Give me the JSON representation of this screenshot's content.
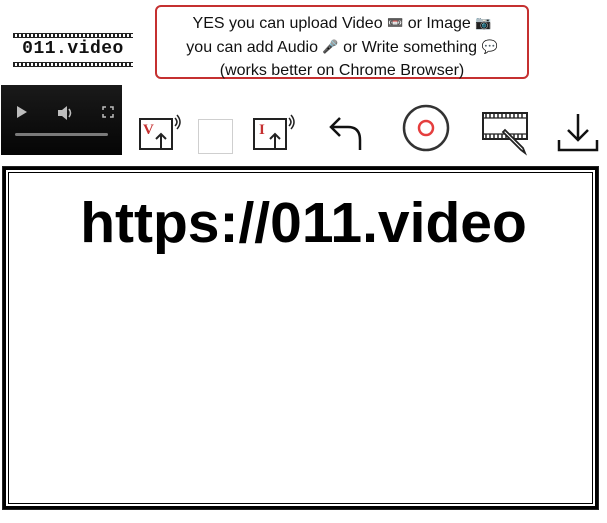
{
  "logo": {
    "text": "011.video"
  },
  "notice": {
    "line1": "YES you can upload Video",
    "line1b": "or Image",
    "line2": "you can add Audio",
    "line2b": "or Write something",
    "line3": "(works better on Chrome Browser)",
    "icons": [
      "video-cassette-icon",
      "camera-icon",
      "microphone-icon",
      "speech-bubble-icon"
    ]
  },
  "player": {
    "controls": [
      "play-icon",
      "volume-icon",
      "fullscreen-icon",
      "seek-bar"
    ]
  },
  "toolbar": {
    "upload_video_letter": "V",
    "upload_image_letter": "I",
    "swatch_color": "#ffffff",
    "accent_color": "#c53030",
    "record_color": "#e53e3e"
  },
  "canvas": {
    "text": "https://011.video"
  }
}
